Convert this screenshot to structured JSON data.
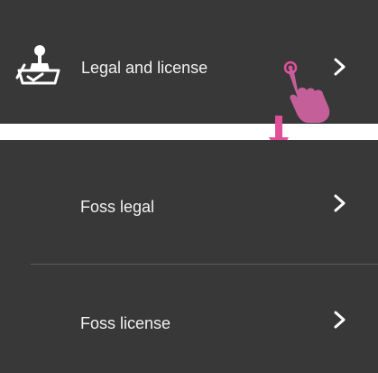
{
  "top_menu": {
    "item_label": "Legal and license",
    "icon": "legal-stamp-icon"
  },
  "sub_menu": {
    "items": [
      {
        "label": "Foss legal"
      },
      {
        "label": "Foss license"
      }
    ]
  },
  "icons": {
    "chevron": "chevron-right-icon",
    "tap_hand": "tap-hand-icon",
    "down_arrow": "down-arrow-icon"
  },
  "colors": {
    "panel_bg": "#383838",
    "text": "#f2f2f2",
    "divider": "#5a5a5a",
    "accent_pink": "#e0509a"
  }
}
